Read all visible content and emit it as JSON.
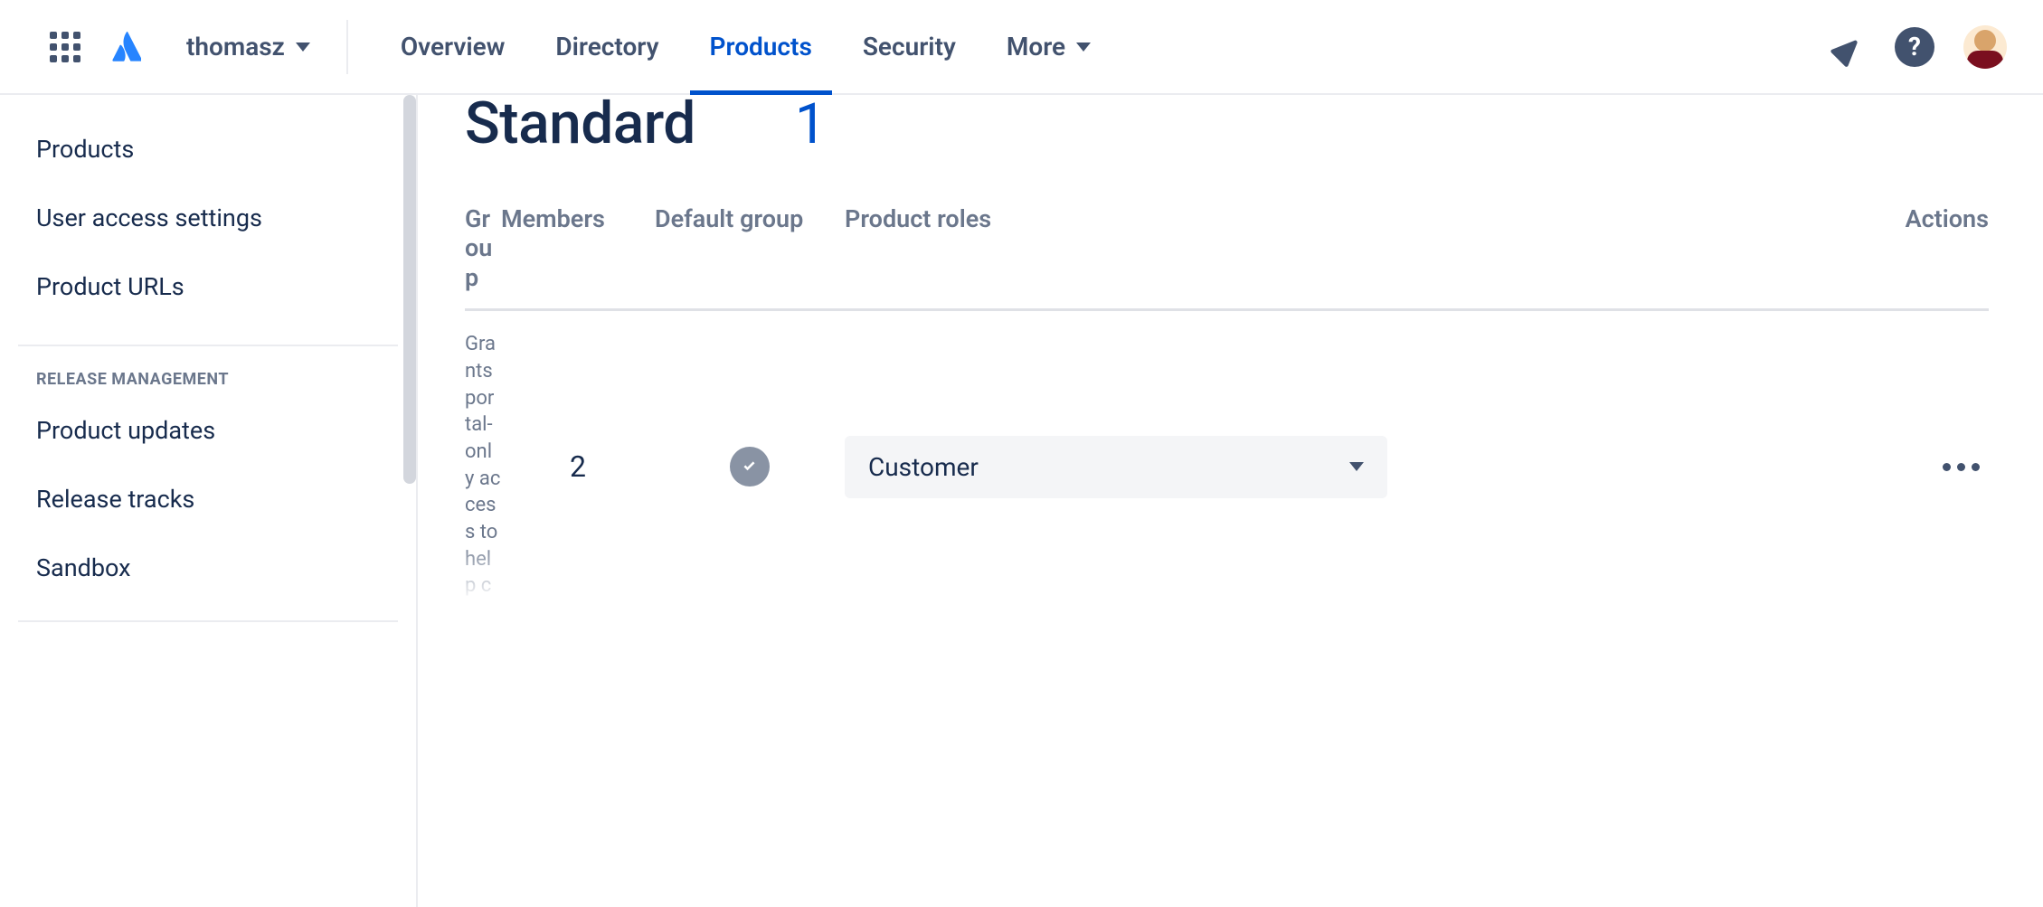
{
  "workspace": "thomasz",
  "nav": {
    "items": [
      "Overview",
      "Directory",
      "Products",
      "Security",
      "More"
    ],
    "active_index": 2
  },
  "sidebar": {
    "items": [
      "Products",
      "User access settings",
      "Product URLs"
    ],
    "section_label": "RELEASE MANAGEMENT",
    "release_items": [
      "Product updates",
      "Release tracks",
      "Sandbox"
    ]
  },
  "page": {
    "title": "Standard",
    "count": "1"
  },
  "table": {
    "headers": {
      "group": "Group",
      "members": "Members",
      "default": "Default group",
      "roles": "Product roles",
      "actions": "Actions"
    },
    "rows": [
      {
        "group_desc": "Grants portal-only access to help center support",
        "members": "2",
        "default": true,
        "role": "Customer"
      }
    ]
  }
}
